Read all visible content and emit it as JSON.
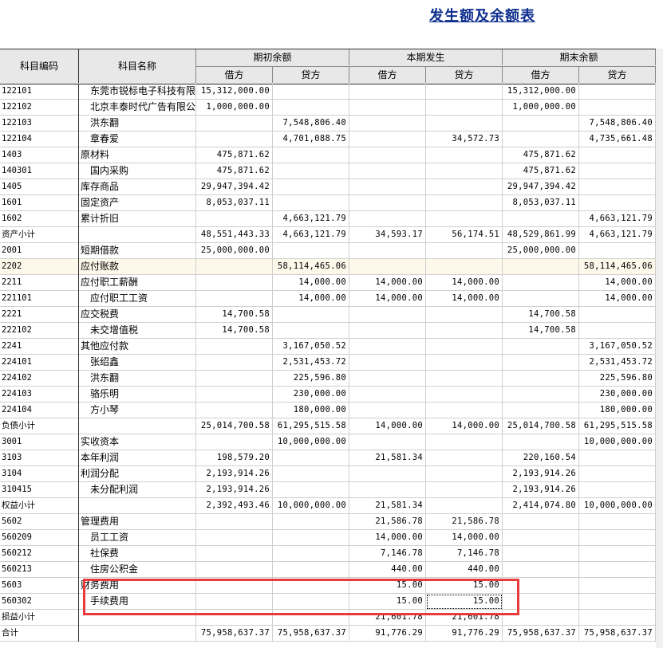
{
  "title": "发生额及余额表",
  "header": {
    "code": "科目编码",
    "name": "科目名称",
    "opening": "期初余额",
    "period": "本期发生",
    "closing": "期末余额",
    "debit": "借方",
    "credit": "贷方"
  },
  "rows": [
    {
      "code": "122101",
      "name": "东莞市锐标电子科技有限公司",
      "indent": true,
      "v": [
        "15,312,000.00",
        "",
        "",
        "",
        "15,312,000.00",
        ""
      ]
    },
    {
      "code": "122102",
      "name": "北京丰泰时代广告有限公司",
      "indent": true,
      "v": [
        "1,000,000.00",
        "",
        "",
        "",
        "1,000,000.00",
        ""
      ]
    },
    {
      "code": "122103",
      "name": "洪东翻",
      "indent": true,
      "v": [
        "",
        "7,548,806.40",
        "",
        "",
        "",
        "7,548,806.40"
      ]
    },
    {
      "code": "122104",
      "name": "章春爱",
      "indent": true,
      "v": [
        "",
        "4,701,088.75",
        "",
        "34,572.73",
        "",
        "4,735,661.48"
      ]
    },
    {
      "code": "1403",
      "name": "原材料",
      "indent": false,
      "v": [
        "475,871.62",
        "",
        "",
        "",
        "475,871.62",
        ""
      ]
    },
    {
      "code": "140301",
      "name": "国内采购",
      "indent": true,
      "v": [
        "475,871.62",
        "",
        "",
        "",
        "475,871.62",
        ""
      ]
    },
    {
      "code": "1405",
      "name": "库存商品",
      "indent": false,
      "v": [
        "29,947,394.42",
        "",
        "",
        "",
        "29,947,394.42",
        ""
      ]
    },
    {
      "code": "1601",
      "name": "固定资产",
      "indent": false,
      "v": [
        "8,053,037.11",
        "",
        "",
        "",
        "8,053,037.11",
        ""
      ]
    },
    {
      "code": "1602",
      "name": "累计折旧",
      "indent": false,
      "v": [
        "",
        "4,663,121.79",
        "",
        "",
        "",
        "4,663,121.79"
      ]
    },
    {
      "code": "资产小计",
      "name": "",
      "indent": false,
      "v": [
        "48,551,443.33",
        "4,663,121.79",
        "34,593.17",
        "56,174.51",
        "48,529,861.99",
        "4,663,121.79"
      ]
    },
    {
      "code": "2001",
      "name": "短期借款",
      "indent": false,
      "v": [
        "25,000,000.00",
        "",
        "",
        "",
        "25,000,000.00",
        ""
      ]
    },
    {
      "code": "2202",
      "name": "应付账款",
      "indent": false,
      "hl": true,
      "v": [
        "",
        "58,114,465.06",
        "",
        "",
        "",
        "58,114,465.06"
      ]
    },
    {
      "code": "2211",
      "name": "应付职工薪酬",
      "indent": false,
      "v": [
        "",
        "14,000.00",
        "14,000.00",
        "14,000.00",
        "",
        "14,000.00"
      ]
    },
    {
      "code": "221101",
      "name": "应付职工工资",
      "indent": true,
      "v": [
        "",
        "14,000.00",
        "14,000.00",
        "14,000.00",
        "",
        "14,000.00"
      ]
    },
    {
      "code": "2221",
      "name": "应交税费",
      "indent": false,
      "v": [
        "14,700.58",
        "",
        "",
        "",
        "14,700.58",
        ""
      ]
    },
    {
      "code": "222102",
      "name": "未交增值税",
      "indent": true,
      "v": [
        "14,700.58",
        "",
        "",
        "",
        "14,700.58",
        ""
      ]
    },
    {
      "code": "2241",
      "name": "其他应付款",
      "indent": false,
      "v": [
        "",
        "3,167,050.52",
        "",
        "",
        "",
        "3,167,050.52"
      ]
    },
    {
      "code": "224101",
      "name": "张绍鑫",
      "indent": true,
      "v": [
        "",
        "2,531,453.72",
        "",
        "",
        "",
        "2,531,453.72"
      ]
    },
    {
      "code": "224102",
      "name": "洪东翻",
      "indent": true,
      "v": [
        "",
        "225,596.80",
        "",
        "",
        "",
        "225,596.80"
      ]
    },
    {
      "code": "224103",
      "name": "骆乐明",
      "indent": true,
      "v": [
        "",
        "230,000.00",
        "",
        "",
        "",
        "230,000.00"
      ]
    },
    {
      "code": "224104",
      "name": "方小琴",
      "indent": true,
      "v": [
        "",
        "180,000.00",
        "",
        "",
        "",
        "180,000.00"
      ]
    },
    {
      "code": "负债小计",
      "name": "",
      "indent": false,
      "v": [
        "25,014,700.58",
        "61,295,515.58",
        "14,000.00",
        "14,000.00",
        "25,014,700.58",
        "61,295,515.58"
      ]
    },
    {
      "code": "3001",
      "name": "实收资本",
      "indent": false,
      "v": [
        "",
        "10,000,000.00",
        "",
        "",
        "",
        "10,000,000.00"
      ]
    },
    {
      "code": "3103",
      "name": "本年利润",
      "indent": false,
      "v": [
        "198,579.20",
        "",
        "21,581.34",
        "",
        "220,160.54",
        ""
      ]
    },
    {
      "code": "3104",
      "name": "利润分配",
      "indent": false,
      "v": [
        "2,193,914.26",
        "",
        "",
        "",
        "2,193,914.26",
        ""
      ]
    },
    {
      "code": "310415",
      "name": "未分配利润",
      "indent": true,
      "v": [
        "2,193,914.26",
        "",
        "",
        "",
        "2,193,914.26",
        ""
      ]
    },
    {
      "code": "权益小计",
      "name": "",
      "indent": false,
      "v": [
        "2,392,493.46",
        "10,000,000.00",
        "21,581.34",
        "",
        "2,414,074.80",
        "10,000,000.00"
      ]
    },
    {
      "code": "5602",
      "name": "管理费用",
      "indent": false,
      "v": [
        "",
        "",
        "21,586.78",
        "21,586.78",
        "",
        ""
      ]
    },
    {
      "code": "560209",
      "name": "员工工资",
      "indent": true,
      "v": [
        "",
        "",
        "14,000.00",
        "14,000.00",
        "",
        ""
      ]
    },
    {
      "code": "560212",
      "name": "社保费",
      "indent": true,
      "v": [
        "",
        "",
        "7,146.78",
        "7,146.78",
        "",
        ""
      ]
    },
    {
      "code": "560213",
      "name": "住房公积金",
      "indent": true,
      "v": [
        "",
        "",
        "440.00",
        "440.00",
        "",
        ""
      ]
    },
    {
      "code": "5603",
      "name": "财务费用",
      "indent": false,
      "v": [
        "",
        "",
        "15.00",
        "15.00",
        "",
        ""
      ]
    },
    {
      "code": "560302",
      "name": "手续费用",
      "indent": true,
      "v": [
        "",
        "",
        "15.00",
        "15.00",
        "",
        ""
      ],
      "selected": 3
    },
    {
      "code": "损益小计",
      "name": "",
      "indent": false,
      "v": [
        "",
        "",
        "21,601.78",
        "21,601.78",
        "",
        ""
      ]
    },
    {
      "code": "合计",
      "name": "",
      "indent": false,
      "v": [
        "75,958,637.37",
        "75,958,637.37",
        "91,776.29",
        "91,776.29",
        "75,958,637.37",
        "75,958,637.37"
      ]
    }
  ],
  "highlight_color": "#e83a3a"
}
